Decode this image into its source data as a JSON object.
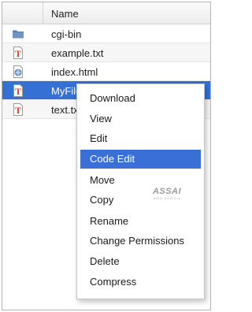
{
  "table": {
    "name_header": "Name"
  },
  "rows": [
    {
      "label": "cgi-bin",
      "icon": "folder-icon"
    },
    {
      "label": "example.txt",
      "icon": "text-file-icon"
    },
    {
      "label": "index.html",
      "icon": "html-file-icon"
    },
    {
      "label": "MyFile",
      "icon": "text-file-icon",
      "selected": true
    },
    {
      "label": "text.txt",
      "icon": "text-file-icon"
    }
  ],
  "context_menu": {
    "items": [
      "Download",
      "View",
      "Edit",
      "Code Edit",
      "Move",
      "Copy",
      "Rename",
      "Change Permissions",
      "Delete",
      "Compress"
    ],
    "active_item": "Code Edit"
  },
  "watermark": {
    "brand": "ASSAI",
    "tagline": "WEB DESIGN"
  },
  "colors": {
    "selection": "#3570d4",
    "menu_highlight": "#3a6fd8",
    "folder": "#5b83b9",
    "text_file_red": "#d9432f"
  }
}
